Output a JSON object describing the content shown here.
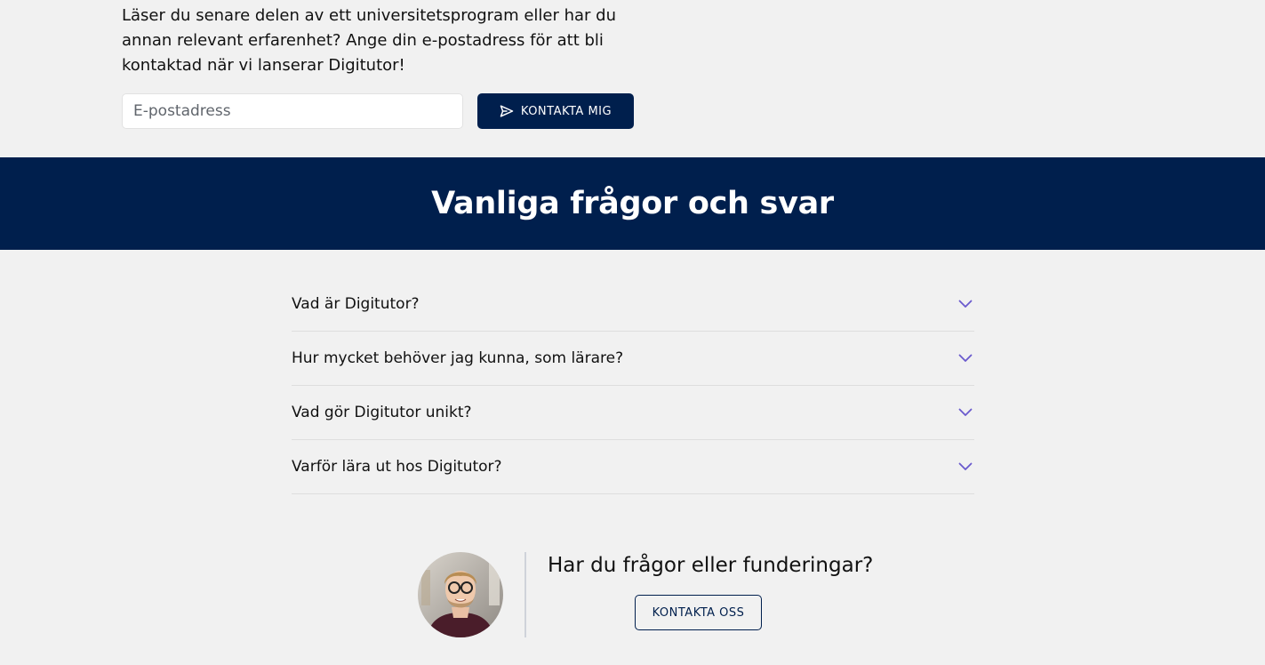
{
  "signup": {
    "intro_text": "Läser du senare delen av ett universitetsprogram eller har du annan relevant erfarenhet? Ange din e-postadress för att bli kontaktad när vi lanserar Digitutor!",
    "email_placeholder": "E-postadress",
    "email_value": "",
    "submit_label": "KONTAKTA MIG",
    "submit_icon": "send-icon"
  },
  "faq": {
    "title": "Vanliga frågor och svar",
    "items": [
      {
        "question": "Vad är Digitutor?",
        "icon": "chevron-down-icon"
      },
      {
        "question": "Hur mycket behöver jag kunna, som lärare?",
        "icon": "chevron-down-icon"
      },
      {
        "question": "Vad gör Digitutor unikt?",
        "icon": "chevron-down-icon"
      },
      {
        "question": "Varför lära ut hos Digitutor?",
        "icon": "chevron-down-icon"
      }
    ]
  },
  "contact": {
    "question": "Har du frågor eller funderingar?",
    "button_label": "KONTAKTA OSS",
    "avatar": "avatar-photo"
  },
  "colors": {
    "primary": "#001f4d",
    "background": "#f1f1f1",
    "chevron": "#6a5acd"
  }
}
